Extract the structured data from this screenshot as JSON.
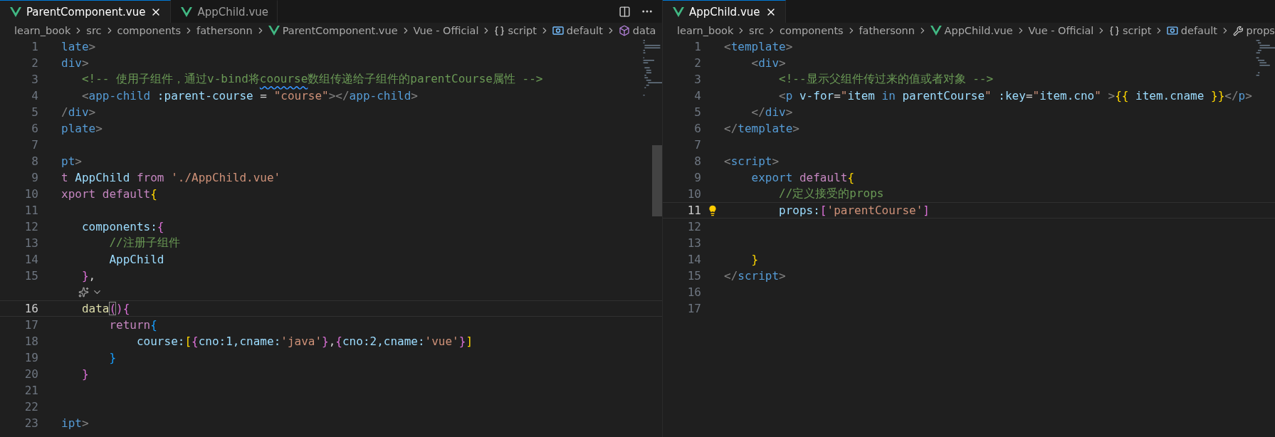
{
  "editors": [
    {
      "tabs": [
        {
          "label": "ParentComponent.vue",
          "selected": true
        },
        {
          "label": "AppChild.vue",
          "selected": false
        }
      ],
      "breadcrumb": [
        {
          "label": "learn_book"
        },
        {
          "label": "src"
        },
        {
          "label": "components"
        },
        {
          "label": "fathersonn"
        },
        {
          "label": "ParentComponent.vue",
          "kind": "vue"
        },
        {
          "label": "Vue - Official"
        },
        {
          "label": "script",
          "kind": "braces"
        },
        {
          "label": "default",
          "kind": "module"
        },
        {
          "label": "data",
          "kind": "cube"
        }
      ],
      "lines": [
        {
          "number": "1",
          "current": false,
          "tokens": [
            {
              "text": "late",
              "kind": "tag"
            },
            {
              "text": ">",
              "kind": "punct"
            }
          ]
        },
        {
          "number": "2",
          "current": false,
          "tokens": [
            {
              "text": "div",
              "kind": "tag"
            },
            {
              "text": ">",
              "kind": "punct"
            }
          ]
        },
        {
          "number": "3",
          "current": false,
          "tokens": [
            {
              "text": "   <!-- 使用子组件，通过v-bind将",
              "kind": "comment"
            },
            {
              "text": "coourse",
              "kind": "spell"
            },
            {
              "text": "数组传递给子组件的parentCourse属性 -->",
              "kind": "comment"
            }
          ]
        },
        {
          "number": "4",
          "current": false,
          "tokens": [
            {
              "text": "   <",
              "kind": "punct"
            },
            {
              "text": "app-child",
              "kind": "tag"
            },
            {
              "text": " :parent-course",
              "kind": "attr"
            },
            {
              "text": " = ",
              "kind": "plain"
            },
            {
              "text": "\"course\"",
              "kind": "string2"
            },
            {
              "text": "></",
              "kind": "punct"
            },
            {
              "text": "app-child",
              "kind": "tag"
            },
            {
              "text": ">",
              "kind": "punct"
            }
          ]
        },
        {
          "number": "5",
          "current": false,
          "tokens": [
            {
              "text": "/",
              "kind": "punct"
            },
            {
              "text": "div",
              "kind": "tag"
            },
            {
              "text": ">",
              "kind": "punct"
            }
          ]
        },
        {
          "number": "6",
          "current": false,
          "tokens": [
            {
              "text": "plate",
              "kind": "tag"
            },
            {
              "text": ">",
              "kind": "punct"
            }
          ]
        },
        {
          "number": "7",
          "current": false
        },
        {
          "number": "8",
          "current": false,
          "tokens": [
            {
              "text": "pt",
              "kind": "tag"
            },
            {
              "text": ">",
              "kind": "punct"
            }
          ]
        },
        {
          "number": "9",
          "current": false,
          "tokens": [
            {
              "text": "t ",
              "kind": "keyword"
            },
            {
              "text": "AppChild",
              "kind": "var"
            },
            {
              "text": " from ",
              "kind": "keyword"
            },
            {
              "text": "'./AppChild.vue'",
              "kind": "string"
            }
          ]
        },
        {
          "number": "10",
          "current": false,
          "tokens": [
            {
              "text": "xport default",
              "kind": "keyword"
            },
            {
              "text": "{",
              "kind": "b1"
            }
          ]
        },
        {
          "number": "11",
          "current": false
        },
        {
          "number": "12",
          "current": false,
          "tokens": [
            {
              "text": "   components:",
              "kind": "var"
            },
            {
              "text": "{",
              "kind": "b2"
            }
          ]
        },
        {
          "number": "13",
          "current": false,
          "tokens": [
            {
              "text": "       //注册子组件",
              "kind": "comment"
            }
          ]
        },
        {
          "number": "14",
          "current": false,
          "tokens": [
            {
              "text": "       AppChild",
              "kind": "var"
            }
          ]
        },
        {
          "number": "15",
          "current": false,
          "tokens": [
            {
              "text": "   }",
              "kind": "b2"
            },
            {
              "text": ",",
              "kind": "plain"
            }
          ]
        },
        {
          "number": "16",
          "current": true,
          "codelens": true,
          "tokens": [
            {
              "text": "   data",
              "kind": "fn"
            },
            {
              "text": "(",
              "kind": "match"
            },
            {
              "text": ")",
              "kind": "b2"
            },
            {
              "text": "{",
              "kind": "b2"
            }
          ]
        },
        {
          "number": "17",
          "current": false,
          "tokens": [
            {
              "text": "       return",
              "kind": "keyword"
            },
            {
              "text": "{",
              "kind": "b3"
            }
          ]
        },
        {
          "number": "18",
          "current": false,
          "tokens": [
            {
              "text": "           course:",
              "kind": "var"
            },
            {
              "text": "[",
              "kind": "b1"
            },
            {
              "text": "{",
              "kind": "b2"
            },
            {
              "text": "cno:1,cname:",
              "kind": "var"
            },
            {
              "text": "'java'",
              "kind": "string"
            },
            {
              "text": "}",
              "kind": "b2"
            },
            {
              "text": ",",
              "kind": "plain"
            },
            {
              "text": "{",
              "kind": "b2"
            },
            {
              "text": "cno:2,cname:",
              "kind": "var"
            },
            {
              "text": "'vue'",
              "kind": "string"
            },
            {
              "text": "}",
              "kind": "b2"
            },
            {
              "text": "]",
              "kind": "b1"
            }
          ]
        },
        {
          "number": "19",
          "current": false,
          "tokens": [
            {
              "text": "       }",
              "kind": "b3"
            }
          ]
        },
        {
          "number": "20",
          "current": false,
          "tokens": [
            {
              "text": "   }",
              "kind": "b2"
            }
          ]
        },
        {
          "number": "21",
          "current": false
        },
        {
          "number": "22",
          "current": false
        },
        {
          "number": "23",
          "current": false,
          "tokens": [
            {
              "text": "ipt",
              "kind": "tag"
            },
            {
              "text": ">",
              "kind": "punct"
            }
          ]
        }
      ]
    },
    {
      "tabs": [
        {
          "label": "AppChild.vue",
          "selected": true
        }
      ],
      "breadcrumb": [
        {
          "label": "learn_book"
        },
        {
          "label": "src"
        },
        {
          "label": "components"
        },
        {
          "label": "fathersonn"
        },
        {
          "label": "AppChild.vue",
          "kind": "vue"
        },
        {
          "label": "Vue - Official"
        },
        {
          "label": "script",
          "kind": "braces"
        },
        {
          "label": "default",
          "kind": "module"
        },
        {
          "label": "props",
          "kind": "wrench"
        }
      ],
      "lines": [
        {
          "number": "1",
          "current": false,
          "tokens": [
            {
              "text": "<",
              "kind": "punct"
            },
            {
              "text": "template",
              "kind": "tag"
            },
            {
              "text": ">",
              "kind": "punct"
            }
          ]
        },
        {
          "number": "2",
          "current": false,
          "tokens": [
            {
              "text": "    <",
              "kind": "punct"
            },
            {
              "text": "div",
              "kind": "tag"
            },
            {
              "text": ">",
              "kind": "punct"
            }
          ]
        },
        {
          "number": "3",
          "current": false,
          "tokens": [
            {
              "text": "        <!--显示父组件传过来的值或者对象 -->",
              "kind": "comment"
            }
          ]
        },
        {
          "number": "4",
          "current": false,
          "tokens": [
            {
              "text": "        <",
              "kind": "punct"
            },
            {
              "text": "p",
              "kind": "tag"
            },
            {
              "text": " v-for",
              "kind": "attr"
            },
            {
              "text": "=",
              "kind": "plain"
            },
            {
              "text": "\"",
              "kind": "string2"
            },
            {
              "text": "item",
              "kind": "var"
            },
            {
              "text": " in ",
              "kind": "tag"
            },
            {
              "text": "parentCourse",
              "kind": "var"
            },
            {
              "text": "\"",
              "kind": "string2"
            },
            {
              "text": " :key",
              "kind": "attr"
            },
            {
              "text": "=",
              "kind": "plain"
            },
            {
              "text": "\"",
              "kind": "string2"
            },
            {
              "text": "item.cno",
              "kind": "var"
            },
            {
              "text": "\" ",
              "kind": "string2"
            },
            {
              "text": ">",
              "kind": "punct"
            },
            {
              "text": "{{",
              "kind": "b1"
            },
            {
              "text": " item.cname ",
              "kind": "var"
            },
            {
              "text": "}}",
              "kind": "b1"
            },
            {
              "text": "</",
              "kind": "punct"
            },
            {
              "text": "p",
              "kind": "tag"
            },
            {
              "text": ">",
              "kind": "punct"
            }
          ]
        },
        {
          "number": "5",
          "current": false,
          "tokens": [
            {
              "text": "    </",
              "kind": "punct"
            },
            {
              "text": "div",
              "kind": "tag"
            },
            {
              "text": ">",
              "kind": "punct"
            }
          ]
        },
        {
          "number": "6",
          "current": false,
          "tokens": [
            {
              "text": "</",
              "kind": "punct"
            },
            {
              "text": "template",
              "kind": "tag"
            },
            {
              "text": ">",
              "kind": "punct"
            }
          ]
        },
        {
          "number": "7",
          "current": false
        },
        {
          "number": "8",
          "current": false,
          "tokens": [
            {
              "text": "<",
              "kind": "punct"
            },
            {
              "text": "script",
              "kind": "tag"
            },
            {
              "text": ">",
              "kind": "punct"
            }
          ]
        },
        {
          "number": "9",
          "current": false,
          "tokens": [
            {
              "text": "    export ",
              "kind": "tag"
            },
            {
              "text": "default",
              "kind": "keyword"
            },
            {
              "text": "{",
              "kind": "b1"
            }
          ]
        },
        {
          "number": "10",
          "current": false,
          "tokens": [
            {
              "text": "        //定义接受的props",
              "kind": "comment"
            }
          ]
        },
        {
          "number": "11",
          "current": true,
          "bulb": true,
          "tokens": [
            {
              "text": "        props:",
              "kind": "var"
            },
            {
              "text": "[",
              "kind": "b2"
            },
            {
              "text": "'parentCourse'",
              "kind": "string"
            },
            {
              "text": "]",
              "kind": "b2"
            }
          ]
        },
        {
          "number": "12",
          "current": false
        },
        {
          "number": "13",
          "current": false
        },
        {
          "number": "14",
          "current": false,
          "tokens": [
            {
              "text": "    }",
              "kind": "b1"
            }
          ]
        },
        {
          "number": "15",
          "current": false,
          "tokens": [
            {
              "text": "</",
              "kind": "punct"
            },
            {
              "text": "script",
              "kind": "tag"
            },
            {
              "text": ">",
              "kind": "punct"
            }
          ]
        },
        {
          "number": "16",
          "current": false
        },
        {
          "number": "17",
          "current": false
        }
      ]
    }
  ]
}
